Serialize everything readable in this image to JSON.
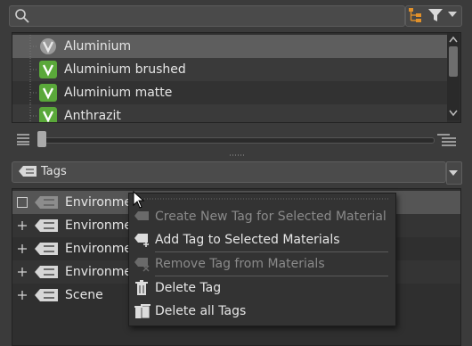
{
  "search": {
    "value": "",
    "placeholder": ""
  },
  "toolbar": {
    "icons": [
      "search-icon",
      "hierarchy-icon",
      "filter-icon",
      "chevron-down-icon"
    ]
  },
  "materials": {
    "items": [
      {
        "label": "Aluminium",
        "selected": true
      },
      {
        "label": "Aluminium brushed",
        "selected": false
      },
      {
        "label": "Aluminium matte",
        "selected": false
      },
      {
        "label": "Anthrazit",
        "selected": false
      }
    ]
  },
  "zoom": {
    "value": 0.0
  },
  "tags_dropdown": {
    "label": "Tags"
  },
  "tags_tree": {
    "items": [
      {
        "label": "Environme",
        "highlighted": true
      },
      {
        "label": "Environme"
      },
      {
        "label": "Environme"
      },
      {
        "label": "Environme"
      },
      {
        "label": "Scene"
      }
    ]
  },
  "context_menu": {
    "items": [
      {
        "label": "Create New Tag for Selected Material",
        "enabled": false
      },
      {
        "label": "Add Tag to Selected Materials",
        "enabled": true
      },
      {
        "label": "Remove Tag from Materials",
        "enabled": false
      },
      {
        "label": "Delete Tag",
        "enabled": true
      },
      {
        "label": "Delete all Tags",
        "enabled": true
      }
    ]
  },
  "colors": {
    "background": "#3b3b3b",
    "panel": "#2f2f2f",
    "selection": "#5e5e5e",
    "material_green": "#5aa83a",
    "hierarchy_orange": "#e0902a"
  }
}
